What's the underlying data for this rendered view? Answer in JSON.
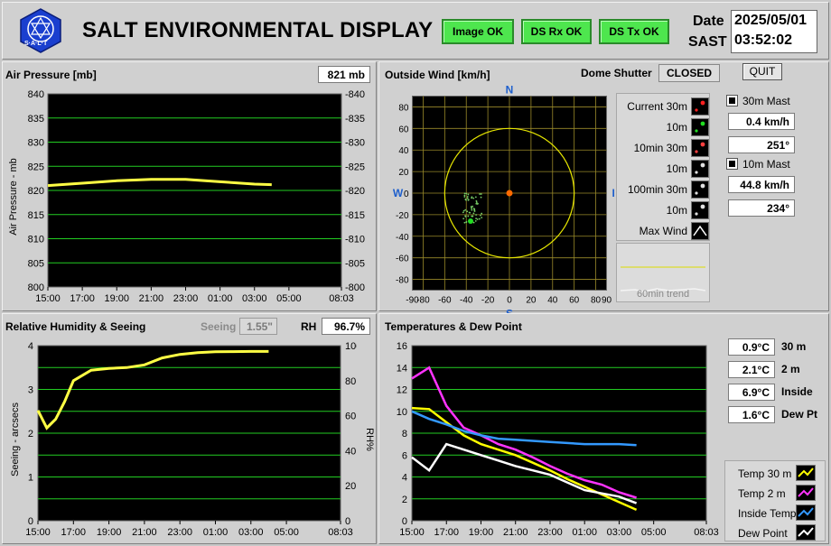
{
  "header": {
    "title": "SALT ENVIRONMENTAL DISPLAY",
    "logo_text": "S·A·L·T",
    "status": [
      "Image OK",
      "DS Rx OK",
      "DS Tx OK"
    ],
    "date_label": "Date",
    "date_value": "2025/05/01",
    "time_label": "SAST",
    "time_value": "03:52:02"
  },
  "pressure": {
    "title": "Air Pressure [mb]",
    "value": "821 mb",
    "ylabel": "Air Pressure - mb",
    "yticks": [
      "840",
      "835",
      "830",
      "825",
      "820",
      "815",
      "810",
      "805",
      "800"
    ],
    "xticks": [
      "15:00",
      "17:00",
      "19:00",
      "21:00",
      "23:00",
      "01:00",
      "03:00",
      "05:00",
      "08:03"
    ]
  },
  "wind": {
    "title": "Outside Wind [km/h]",
    "shutter_label": "Dome Shutter",
    "shutter_value": "CLOSED",
    "quit_label": "QUIT",
    "compass": {
      "n": "N",
      "s": "S",
      "e": "E",
      "w": "W"
    },
    "yticks": [
      "80",
      "60",
      "40",
      "20",
      "0",
      "-20",
      "-40",
      "-60",
      "-80"
    ],
    "xticks": [
      "-90",
      "-80",
      "-60",
      "-40",
      "-20",
      "0",
      "20",
      "40",
      "60",
      "80",
      "90"
    ],
    "legend": [
      "Current 30m",
      "10m",
      "10min 30m",
      "10m",
      "100min 30m",
      "10m",
      "Max Wind"
    ],
    "trend_label": "60min trend",
    "mast30_label": "30m Mast",
    "mast30_speed": "0.4 km/h",
    "mast30_dir": "251°",
    "mast10_label": "10m Mast",
    "mast10_speed": "44.8 km/h",
    "mast10_dir": "234°"
  },
  "humidity": {
    "title": "Relative Humidity & Seeing",
    "seeing_label": "Seeing",
    "seeing_value": "1.55\"",
    "rh_label": "RH",
    "rh_value": "96.7%",
    "ylabel_left": "Seeing - arcsecs",
    "ylabel_right": "RH%",
    "yticks_left": [
      "4",
      "3",
      "2",
      "1",
      "0"
    ],
    "yticks_right": [
      "100",
      "80",
      "60",
      "40",
      "20",
      "0"
    ],
    "xticks": [
      "15:00",
      "17:00",
      "19:00",
      "21:00",
      "23:00",
      "01:00",
      "03:00",
      "05:00",
      "08:03"
    ]
  },
  "temps": {
    "title": "Temperatures & Dew Point",
    "yticks": [
      "16",
      "14",
      "12",
      "10",
      "8",
      "6",
      "4",
      "2",
      "0"
    ],
    "xticks": [
      "15:00",
      "17:00",
      "19:00",
      "21:00",
      "23:00",
      "01:00",
      "03:00",
      "05:00",
      "08:03"
    ],
    "readings": [
      {
        "value": "0.9°C",
        "label": "30 m"
      },
      {
        "value": "2.1°C",
        "label": "2 m"
      },
      {
        "value": "6.9°C",
        "label": "Inside"
      },
      {
        "value": "1.6°C",
        "label": "Dew Pt"
      }
    ],
    "legend": [
      {
        "name": "Temp 30 m",
        "color": "#ffff00"
      },
      {
        "name": "Temp 2 m",
        "color": "#ff33ff"
      },
      {
        "name": "Inside Temp",
        "color": "#3399ff"
      },
      {
        "name": "Dew Point",
        "color": "#ffffff"
      }
    ]
  },
  "colors": {
    "plot_bg": "#000000",
    "grid": "#22cc22",
    "pressure": "#ffff44",
    "ok_green": "#4ee64e"
  },
  "chart_data": [
    {
      "type": "line",
      "title": "Air Pressure [mb]",
      "ylabel": "Air Pressure - mb",
      "ylim": [
        800,
        840
      ],
      "x": [
        "15:00",
        "17:00",
        "19:00",
        "21:00",
        "23:00",
        "01:00",
        "03:00",
        "04:00"
      ],
      "series": [
        {
          "values": [
            821.0,
            821.5,
            822.0,
            822.3,
            822.3,
            821.8,
            821.3,
            821.2
          ],
          "color": "#ffff44"
        }
      ]
    },
    {
      "type": "line",
      "title": "Relative Humidity & Seeing",
      "ylabel": "Seeing - arcsecs",
      "y2label": "RH%",
      "ylim": [
        0,
        4
      ],
      "y2lim": [
        0,
        100
      ],
      "x": [
        "15:00",
        "15:30",
        "16:00",
        "16:30",
        "17:00",
        "18:00",
        "19:00",
        "20:00",
        "21:00",
        "22:00",
        "23:00",
        "00:00",
        "01:00",
        "02:00",
        "03:00",
        "04:00"
      ],
      "series": [
        {
          "name": "RH",
          "axis": "right",
          "values": [
            63,
            53,
            58,
            68,
            80,
            86,
            87,
            87.5,
            89,
            93,
            95,
            96,
            96.5,
            96.6,
            96.7,
            96.7
          ]
        }
      ]
    },
    {
      "type": "line",
      "title": "Temperatures & Dew Point",
      "ylim": [
        0,
        16
      ],
      "x": [
        "15:00",
        "16:00",
        "17:00",
        "18:00",
        "19:00",
        "20:00",
        "21:00",
        "22:00",
        "23:00",
        "00:00",
        "01:00",
        "02:00",
        "03:00",
        "04:00"
      ],
      "series": [
        {
          "name": "Temp 30 m",
          "values": [
            10.3,
            10.2,
            9.0,
            7.8,
            7.0,
            6.5,
            6.0,
            5.3,
            4.6,
            3.8,
            3.1,
            2.4,
            1.7,
            1.0
          ]
        },
        {
          "name": "Temp 2 m",
          "values": [
            13.0,
            14.0,
            10.5,
            8.5,
            7.8,
            7.0,
            6.5,
            5.8,
            5.0,
            4.3,
            3.7,
            3.3,
            2.6,
            2.1
          ]
        },
        {
          "name": "Inside Temp",
          "values": [
            10.0,
            9.3,
            8.8,
            8.2,
            7.8,
            7.5,
            7.4,
            7.3,
            7.2,
            7.1,
            7.0,
            7.0,
            7.0,
            6.9
          ]
        },
        {
          "name": "Dew Point",
          "values": [
            5.8,
            4.6,
            7.0,
            6.5,
            6.0,
            5.5,
            5.0,
            4.6,
            4.2,
            3.5,
            2.8,
            2.5,
            2.2,
            1.6
          ]
        }
      ]
    },
    {
      "type": "scatter",
      "title": "Outside Wind [km/h]",
      "xlim": [
        -90,
        90
      ],
      "ylim": [
        -90,
        90
      ],
      "series": [
        {
          "name": "Current 30m",
          "points": [
            [
              0,
              0
            ]
          ]
        },
        {
          "name": "10m",
          "points": [
            [
              -36,
              -26
            ]
          ]
        }
      ]
    }
  ]
}
